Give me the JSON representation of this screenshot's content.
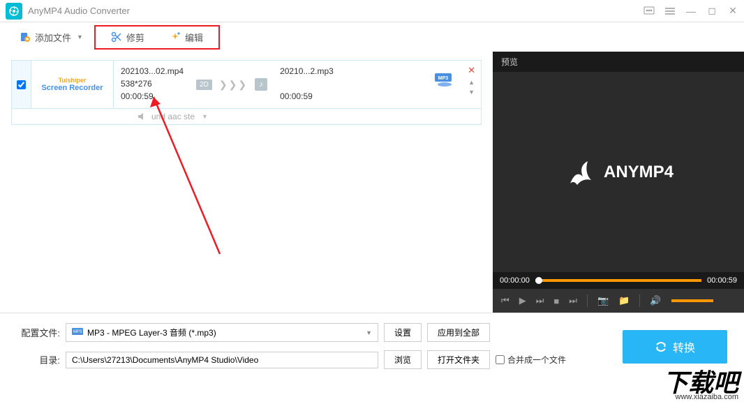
{
  "app": {
    "title": "AnyMP4 Audio Converter"
  },
  "toolbar": {
    "add_file": "添加文件",
    "trim": "修剪",
    "edit": "编辑"
  },
  "file": {
    "thumb_line1": "Tuishiper",
    "thumb_line2": "Screen Recorder",
    "src_name": "202103...02.mp4",
    "src_res": "538*276",
    "src_dur": "00:00:59",
    "badge_2d": "2D",
    "dst_name": "20210...2.mp3",
    "dst_dur": "00:00:59",
    "audio_track": "und aac ste"
  },
  "preview": {
    "header": "预览",
    "brand": "ANYMP4",
    "time_start": "00:00:00",
    "time_end": "00:00:59"
  },
  "bottom": {
    "profile_label": "配置文件:",
    "profile_value": "MP3 - MPEG Layer-3 音频 (*.mp3)",
    "settings": "设置",
    "apply_all": "应用到全部",
    "dir_label": "目录:",
    "dir_value": "C:\\Users\\27213\\Documents\\AnyMP4 Studio\\Video",
    "browse": "浏览",
    "open_folder": "打开文件夹",
    "merge": "合并成一个文件",
    "convert": "转换"
  },
  "watermark": {
    "text": "下载吧",
    "url": "www.xiazaiba.com"
  }
}
